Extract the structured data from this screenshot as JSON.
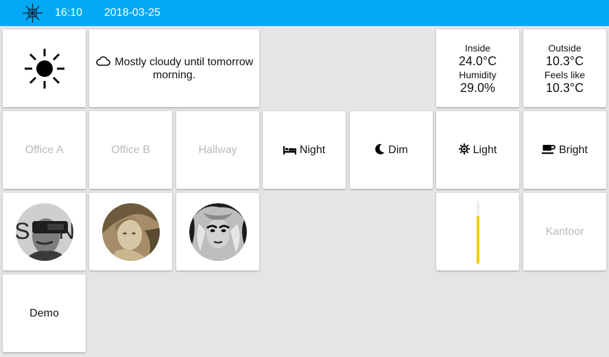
{
  "header": {
    "time": "16:10",
    "date": "2018-03-25",
    "logo_icon": "compass-star-icon",
    "bar_color": "#03a9f4"
  },
  "weather": {
    "icon": "sun-icon",
    "summary_icon": "cloud-icon",
    "summary": "Mostly cloudy until tomorrow morning."
  },
  "sensors": {
    "inside": {
      "label": "Inside",
      "temperature": "24.0°C",
      "humidity_label": "Humidity",
      "humidity": "29.0%"
    },
    "outside": {
      "label": "Outside",
      "temperature": "10.3°C",
      "feels_label": "Feels like",
      "feels": "10.3°C"
    }
  },
  "rooms": {
    "office_a": "Office A",
    "office_b": "Office B",
    "hallway": "Hallway",
    "kantoor": "Kantoor",
    "demo": "Demo"
  },
  "scenes": {
    "night": {
      "label": "Night",
      "icon": "bed-icon"
    },
    "dim": {
      "label": "Dim",
      "icon": "moon-icon"
    },
    "light": {
      "label": "Light",
      "icon": "sun-small-icon"
    },
    "bright": {
      "label": "Bright",
      "icon": "coffee-cup-icon"
    }
  },
  "cameras": [
    {
      "name": "camera-vr-headset"
    },
    {
      "name": "camera-statue"
    },
    {
      "name": "camera-portrait"
    }
  ],
  "dimmer": {
    "level": 0.76,
    "fill_color": "#f5cf05"
  }
}
